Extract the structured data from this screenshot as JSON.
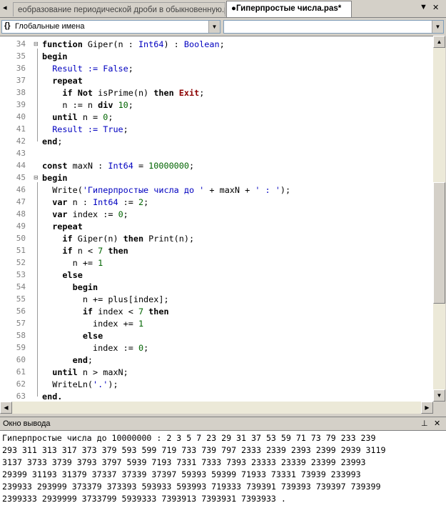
{
  "tabs": [
    {
      "label": "еобразование периодической дроби в обыкновенную.p",
      "active": false
    },
    {
      "label": "●Гиперпростые числа.pas*",
      "active": true
    }
  ],
  "tab_controls": {
    "dropdown": "▼",
    "close": "✕"
  },
  "combos": {
    "left_icon": "{}",
    "left_value": "Глобальные имена",
    "right_value": ""
  },
  "editor": {
    "line_numbers": [
      "34",
      "35",
      "36",
      "37",
      "38",
      "39",
      "40",
      "41",
      "42",
      "43",
      "44",
      "45",
      "46",
      "47",
      "48",
      "49",
      "50",
      "51",
      "52",
      "53",
      "54",
      "55",
      "56",
      "57",
      "58",
      "59",
      "60",
      "61",
      "62",
      "63"
    ],
    "lines": [
      [
        {
          "t": "function ",
          "c": "k"
        },
        {
          "t": "Giper(n : ",
          "c": ""
        },
        {
          "t": "Int64",
          "c": "b"
        },
        {
          "t": ") : ",
          "c": ""
        },
        {
          "t": "Boolean",
          "c": "b"
        },
        {
          "t": ";",
          "c": ""
        }
      ],
      [
        {
          "t": "begin",
          "c": "k"
        }
      ],
      [
        {
          "t": "  Result := ",
          "c": "b"
        },
        {
          "t": "False",
          "c": "b"
        },
        {
          "t": ";",
          "c": ""
        }
      ],
      [
        {
          "t": "  repeat",
          "c": "k"
        }
      ],
      [
        {
          "t": "    ",
          "c": ""
        },
        {
          "t": "if Not ",
          "c": "k"
        },
        {
          "t": "isPrime(n) ",
          "c": ""
        },
        {
          "t": "then ",
          "c": "k"
        },
        {
          "t": "Exit",
          "c": "r"
        },
        {
          "t": ";",
          "c": ""
        }
      ],
      [
        {
          "t": "    n := n ",
          "c": ""
        },
        {
          "t": "div ",
          "c": "k"
        },
        {
          "t": "10",
          "c": "n"
        },
        {
          "t": ";",
          "c": ""
        }
      ],
      [
        {
          "t": "  ",
          "c": ""
        },
        {
          "t": "until ",
          "c": "k"
        },
        {
          "t": "n = ",
          "c": ""
        },
        {
          "t": "0",
          "c": "n"
        },
        {
          "t": ";",
          "c": ""
        }
      ],
      [
        {
          "t": "  Result := ",
          "c": "b"
        },
        {
          "t": "True",
          "c": "b"
        },
        {
          "t": ";",
          "c": ""
        }
      ],
      [
        {
          "t": "end",
          "c": "k"
        },
        {
          "t": ";",
          "c": ""
        }
      ],
      [],
      [
        {
          "t": "const ",
          "c": "k"
        },
        {
          "t": "maxN : ",
          "c": ""
        },
        {
          "t": "Int64",
          "c": "b"
        },
        {
          "t": " = ",
          "c": ""
        },
        {
          "t": "10000000",
          "c": "n"
        },
        {
          "t": ";",
          "c": ""
        }
      ],
      [
        {
          "t": "begin",
          "c": "k"
        }
      ],
      [
        {
          "t": "  Write(",
          "c": ""
        },
        {
          "t": "'Гиперпростые числа до '",
          "c": "b"
        },
        {
          "t": " + maxN + ",
          "c": ""
        },
        {
          "t": "' : '",
          "c": "b"
        },
        {
          "t": ");",
          "c": ""
        }
      ],
      [
        {
          "t": "  ",
          "c": ""
        },
        {
          "t": "var ",
          "c": "k"
        },
        {
          "t": "n : ",
          "c": ""
        },
        {
          "t": "Int64",
          "c": "b"
        },
        {
          "t": " := ",
          "c": ""
        },
        {
          "t": "2",
          "c": "n"
        },
        {
          "t": ";",
          "c": ""
        }
      ],
      [
        {
          "t": "  ",
          "c": ""
        },
        {
          "t": "var ",
          "c": "k"
        },
        {
          "t": "index := ",
          "c": ""
        },
        {
          "t": "0",
          "c": "n"
        },
        {
          "t": ";",
          "c": ""
        }
      ],
      [
        {
          "t": "  repeat",
          "c": "k"
        }
      ],
      [
        {
          "t": "    ",
          "c": ""
        },
        {
          "t": "if ",
          "c": "k"
        },
        {
          "t": "Giper(n) ",
          "c": ""
        },
        {
          "t": "then ",
          "c": "k"
        },
        {
          "t": "Print(n);",
          "c": ""
        }
      ],
      [
        {
          "t": "    ",
          "c": ""
        },
        {
          "t": "if ",
          "c": "k"
        },
        {
          "t": "n < ",
          "c": ""
        },
        {
          "t": "7",
          "c": "n"
        },
        {
          "t": " then",
          "c": "k"
        }
      ],
      [
        {
          "t": "      n += ",
          "c": ""
        },
        {
          "t": "1",
          "c": "n"
        }
      ],
      [
        {
          "t": "    else",
          "c": "k"
        }
      ],
      [
        {
          "t": "      begin",
          "c": "k"
        }
      ],
      [
        {
          "t": "        n += plus[index];",
          "c": ""
        }
      ],
      [
        {
          "t": "        ",
          "c": ""
        },
        {
          "t": "if ",
          "c": "k"
        },
        {
          "t": "index < ",
          "c": ""
        },
        {
          "t": "7",
          "c": "n"
        },
        {
          "t": " then",
          "c": "k"
        }
      ],
      [
        {
          "t": "          index += ",
          "c": ""
        },
        {
          "t": "1",
          "c": "n"
        }
      ],
      [
        {
          "t": "        else",
          "c": "k"
        }
      ],
      [
        {
          "t": "          index := ",
          "c": ""
        },
        {
          "t": "0",
          "c": "n"
        },
        {
          "t": ";",
          "c": ""
        }
      ],
      [
        {
          "t": "      end",
          "c": "k"
        },
        {
          "t": ";",
          "c": ""
        }
      ],
      [
        {
          "t": "  ",
          "c": ""
        },
        {
          "t": "until ",
          "c": "k"
        },
        {
          "t": "n > maxN;",
          "c": ""
        }
      ],
      [
        {
          "t": "  WriteLn(",
          "c": ""
        },
        {
          "t": "'.'",
          "c": "b"
        },
        {
          "t": ");",
          "c": ""
        }
      ],
      [
        {
          "t": "end.",
          "c": "k"
        }
      ]
    ]
  },
  "output_panel": {
    "title": "Окно вывода",
    "pin": "⊥",
    "close": "✕",
    "lines": [
      "Гиперпростые числа до 10000000 : 2 3 5 7 23 29 31 37 53 59 71 73 79 233 239",
      "293 311 313 317 373 379 593 599 719 733 739 797 2333 2339 2393 2399 2939 3119",
      "3137 3733 3739 3793 3797 5939 7193 7331 7333 7393 23333 23339 23399 23993",
      "29399 31193 31379 37337 37339 37397 59393 59399 71933 73331 73939 233993",
      "239933 293999 373379 373393 593933 593993 719333 739391 739393 739397 739399",
      "2399333 2939999 3733799 5939333 7393913 7393931 7393933 ."
    ]
  }
}
